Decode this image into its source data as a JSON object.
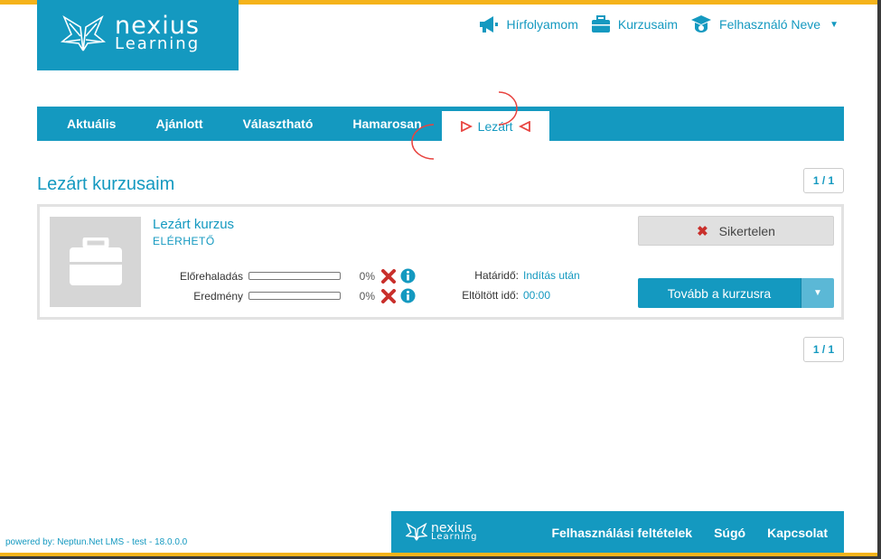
{
  "colors": {
    "brand": "#1499c0",
    "accent": "#f5b31b",
    "error": "#c9302c"
  },
  "brand": {
    "line1": "nexius",
    "line2": "Learning"
  },
  "topnav": {
    "news": {
      "label": "Hírfolyamom",
      "icon": "megaphone-icon"
    },
    "courses": {
      "label": "Kurzusaim",
      "icon": "briefcase-icon"
    },
    "user": {
      "label": "Felhasználó Neve",
      "icon": "graduation-cap-icon"
    }
  },
  "tabs": [
    {
      "label": "Aktuális"
    },
    {
      "label": "Ajánlott"
    },
    {
      "label": "Választható"
    },
    {
      "label": "Hamarosan"
    },
    {
      "label": "Lezárt",
      "active": true
    }
  ],
  "section": {
    "title": "Lezárt kurzusaim"
  },
  "pager": {
    "top": "1 / 1",
    "bottom": "1 / 1"
  },
  "course": {
    "title": "Lezárt kurzus",
    "status": "ELÉRHETŐ",
    "progress": {
      "label": "Előrehaladás",
      "value": 0,
      "display": "0%"
    },
    "result": {
      "label": "Eredmény",
      "value": 0,
      "display": "0%"
    },
    "deadline": {
      "label": "Határidő:",
      "value": "Indítás után"
    },
    "time_spent": {
      "label": "Eltöltött idő:",
      "value": "00:00"
    },
    "fail_button": "Sikertelen",
    "continue_button": "Tovább a kurzusra"
  },
  "footer": {
    "powered": "powered by: Neptun.Net LMS - test - 18.0.0.0",
    "links": [
      "Felhasználási feltételek",
      "Súgó",
      "Kapcsolat"
    ]
  }
}
